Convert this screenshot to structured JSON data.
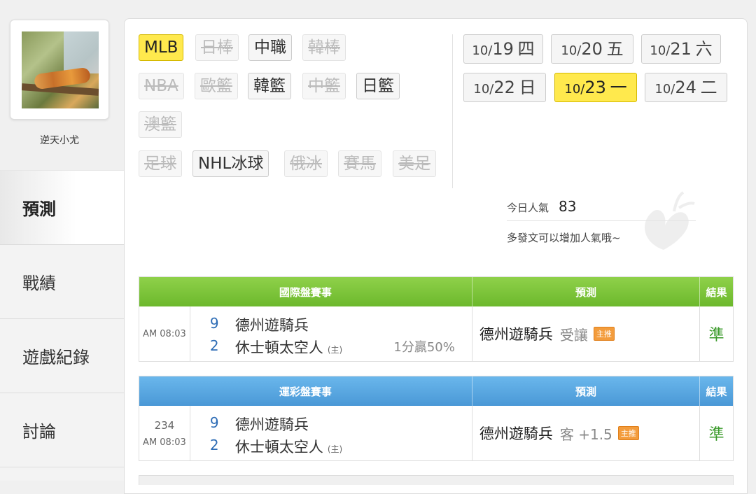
{
  "profile": {
    "username": "逆天小尤"
  },
  "nav": [
    {
      "label": "預測",
      "active": true
    },
    {
      "label": "戰績"
    },
    {
      "label": "遊戲紀錄"
    },
    {
      "label": "討論"
    }
  ],
  "sports": [
    {
      "label": "MLB",
      "state": "active"
    },
    {
      "label": "日棒",
      "state": "dim"
    },
    {
      "label": "中職",
      "state": "normal"
    },
    {
      "label": "韓棒",
      "state": "dim"
    },
    {
      "label": "NBA",
      "state": "dim"
    },
    {
      "label": "歐籃",
      "state": "dim"
    },
    {
      "label": "韓籃",
      "state": "normal"
    },
    {
      "label": "中籃",
      "state": "dim"
    },
    {
      "label": "日籃",
      "state": "normal"
    },
    {
      "label": "澳籃",
      "state": "dim"
    },
    {
      "label": "足球",
      "state": "dim"
    },
    {
      "label": "NHL冰球",
      "state": "normal"
    },
    {
      "label": "俄冰",
      "state": "dim"
    },
    {
      "label": "賽馬",
      "state": "dim"
    },
    {
      "label": "美足",
      "state": "dim"
    }
  ],
  "dates": [
    {
      "month": "10/",
      "day": "19",
      "weekday": "四"
    },
    {
      "month": "10/",
      "day": "20",
      "weekday": "五"
    },
    {
      "month": "10/",
      "day": "21",
      "weekday": "六"
    },
    {
      "month": "10/",
      "day": "22",
      "weekday": "日"
    },
    {
      "month": "10/",
      "day": "23",
      "weekday": "一",
      "active": true
    },
    {
      "month": "10/",
      "day": "24",
      "weekday": "二"
    }
  ],
  "popularity": {
    "label": "今日人氣",
    "value": "83",
    "hint": "多發文可以增加人氣哦~"
  },
  "intl_table": {
    "headers": {
      "match": "國際盤賽事",
      "prediction": "預測",
      "result": "結果"
    },
    "row": {
      "code": "",
      "time": "AM 08:03",
      "away_score": "9",
      "away_team": "德州遊騎兵",
      "home_score": "2",
      "home_team": "休士頓太空人",
      "home_mark": "(主)",
      "odds": "1分贏50%",
      "pred_team": "德州遊騎兵",
      "pred_extra": "受讓",
      "badge": "主推",
      "result": "準"
    }
  },
  "sports_lottery_table": {
    "headers": {
      "match": "運彩盤賽事",
      "prediction": "預測",
      "result": "結果"
    },
    "row": {
      "code": "234",
      "time": "AM 08:03",
      "away_score": "9",
      "away_team": "德州遊騎兵",
      "home_score": "2",
      "home_team": "休士頓太空人",
      "home_mark": "(主)",
      "pred_team": "德州遊騎兵",
      "pred_extra": "客 +1.5",
      "badge": "主推",
      "result": "準"
    }
  }
}
